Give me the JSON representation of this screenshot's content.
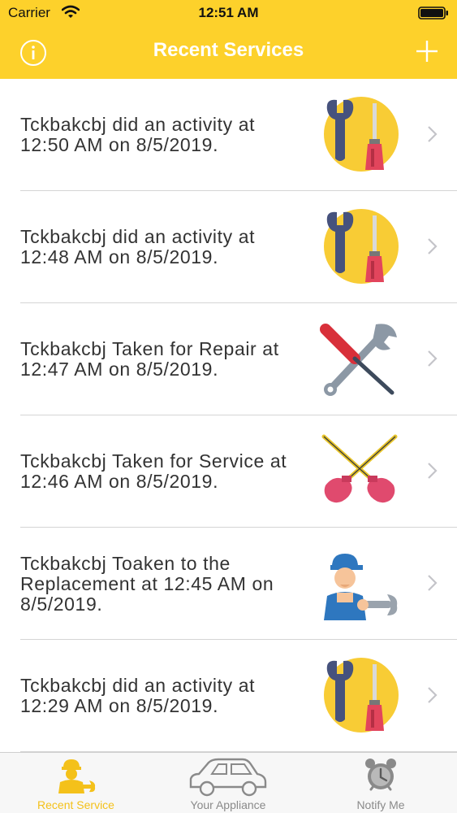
{
  "status_bar": {
    "carrier": "Carrier",
    "time": "12:51 AM"
  },
  "header": {
    "title": "Recent Services",
    "info_icon": "info-icon",
    "add_icon": "plus-icon",
    "background": "#fdd12b"
  },
  "services": [
    {
      "text": "Tckbakcbj did an activity at 12:50 AM on 8/5/2019.",
      "icon": "wrench-screwdriver-icon"
    },
    {
      "text": "Tckbakcbj did an activity at 12:48 AM on 8/5/2019.",
      "icon": "wrench-screwdriver-icon"
    },
    {
      "text": "Tckbakcbj Taken for Repair at 12:47 AM on 8/5/2019.",
      "icon": "crossed-tools-icon"
    },
    {
      "text": "Tckbakcbj Taken for Service at 12:46 AM on 8/5/2019.",
      "icon": "plungers-icon"
    },
    {
      "text": "Tckbakcbj Toaken to the Replacement at 12:45 AM on 8/5/2019.",
      "icon": "repairman-icon"
    },
    {
      "text": "Tckbakcbj did an activity at 12:29 AM on 8/5/2019.",
      "icon": "wrench-screwdriver-icon"
    }
  ],
  "tabs": [
    {
      "label": "Recent Service",
      "icon": "repairman-tab-icon",
      "active": true
    },
    {
      "label": "Your Appliance",
      "icon": "car-icon",
      "active": false
    },
    {
      "label": "Notify Me",
      "icon": "alarm-clock-icon",
      "active": false
    }
  ],
  "colors": {
    "accent": "#fdd12b",
    "active_tab": "#f4c11a",
    "inactive_tab": "#8a8a8a"
  }
}
